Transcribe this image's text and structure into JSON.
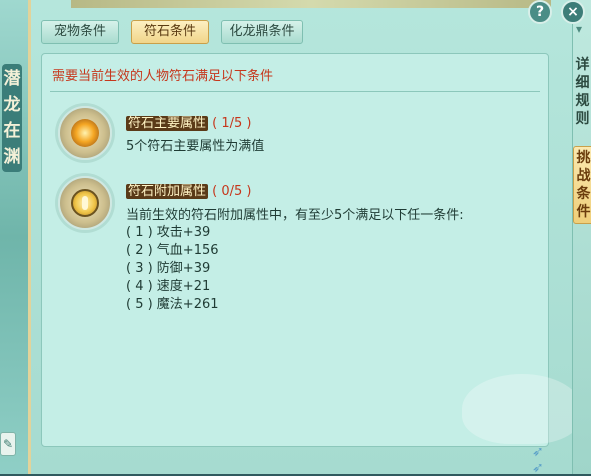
{
  "left": {
    "title": "潜龙在渊",
    "edit_icon": "pencil-icon"
  },
  "tabs": [
    {
      "label": "宠物条件",
      "active": false
    },
    {
      "label": "符石条件",
      "active": true
    },
    {
      "label": "化龙鼎条件",
      "active": false
    }
  ],
  "panel": {
    "title": "需要当前生效的人物符石满足以下条件",
    "rune1": {
      "icon": "rune-main-attr-icon",
      "name": "符石主要属性",
      "progress": "( 1/5 )",
      "desc": "5个符石主要属性为满值"
    },
    "rune2": {
      "icon": "rune-extra-attr-icon",
      "name": "符石附加属性",
      "progress": "( 0/5 )",
      "desc": "当前生效的符石附加属性中，有至少5个满足以下任一条件:",
      "conditions": [
        "( 1 ) 攻击+39",
        "( 2 ) 气血+156",
        "( 3 ) 防御+39",
        "( 4 ) 速度+21",
        "( 5 ) 魔法+261"
      ]
    }
  },
  "right": {
    "detail_rules": "详细规则",
    "challenge_conditions": "挑战条件"
  },
  "buttons": {
    "help": "?",
    "close": "×"
  },
  "colors": {
    "accent_red": "#c6371c",
    "active_tab": "#f1d58a",
    "panel_bg": "#c4eee6"
  }
}
